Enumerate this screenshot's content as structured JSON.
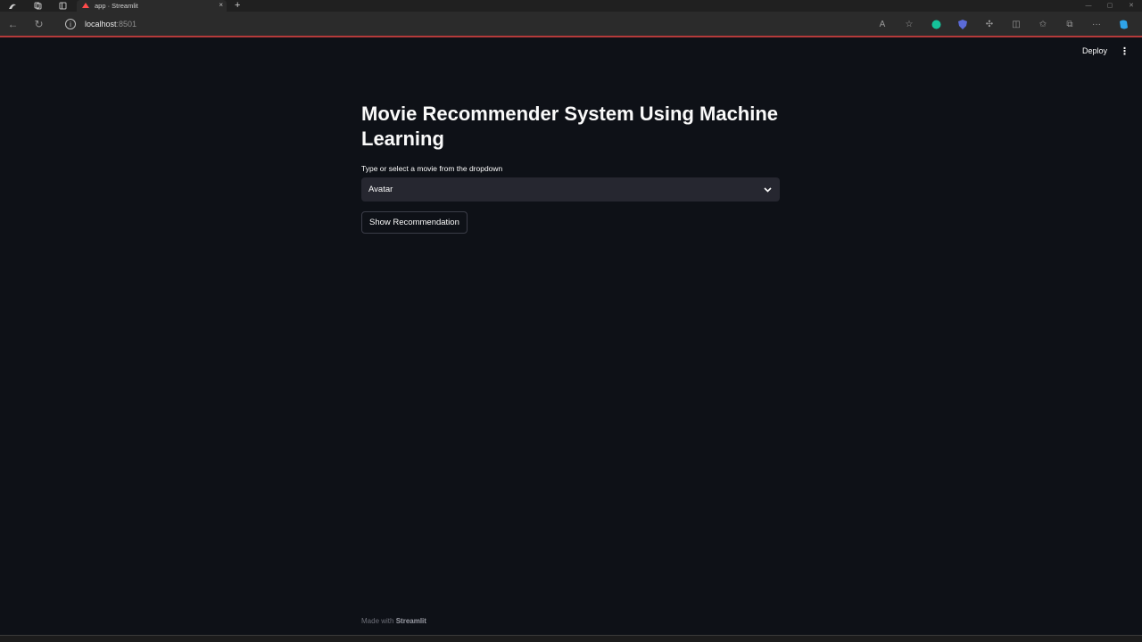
{
  "browser": {
    "tab_title": "app · Streamlit",
    "tab_close": "×",
    "new_tab": "+",
    "url_host": "localhost",
    "url_port": ":8501",
    "accent_loading_line": "#b43a3a"
  },
  "app": {
    "deploy_label": "Deploy",
    "menu_glyph": "⋮",
    "title": "Movie Recommender System Using Machine Learning",
    "select_label": "Type or select a movie from the dropdown",
    "selected_movie": "Avatar",
    "button_label": "Show Recommendation",
    "footer_prefix": "Made with",
    "footer_brand": "Streamlit"
  },
  "colors": {
    "background": "#0e1117",
    "select_bg": "#262730",
    "text": "#fafafa"
  }
}
